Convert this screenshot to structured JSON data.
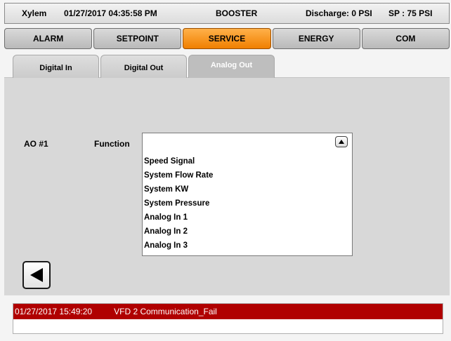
{
  "header": {
    "brand": "Xylem",
    "datetime": "01/27/2017 04:35:58 PM",
    "mode": "BOOSTER",
    "discharge": "Discharge: 0 PSI",
    "setpoint": "SP : 75 PSI"
  },
  "main_tabs": [
    {
      "label": "ALARM",
      "active": false
    },
    {
      "label": "SETPOINT",
      "active": false
    },
    {
      "label": "SERVICE",
      "active": true
    },
    {
      "label": "ENERGY",
      "active": false
    },
    {
      "label": "COM",
      "active": false
    }
  ],
  "sub_tabs": [
    {
      "label": "Digital In",
      "active": false
    },
    {
      "label": "Digital Out",
      "active": false
    },
    {
      "label": "Analog Out",
      "active": true
    }
  ],
  "form": {
    "ao_label": "AO #1",
    "function_label": "Function",
    "function_value": "",
    "options": [
      "Speed Signal",
      "System Flow Rate",
      "System KW",
      "System Pressure",
      "Analog In 1",
      "Analog In 2",
      "Analog In 3"
    ]
  },
  "icons": {
    "dropdown": "triangle-up-icon",
    "back": "back-arrow-icon"
  },
  "colors": {
    "active_tab": "#f07f00",
    "alarm_bg": "#b00000"
  },
  "alarm": {
    "time": "01/27/2017 15:49:20",
    "message": "VFD 2 Communication_Fail"
  }
}
